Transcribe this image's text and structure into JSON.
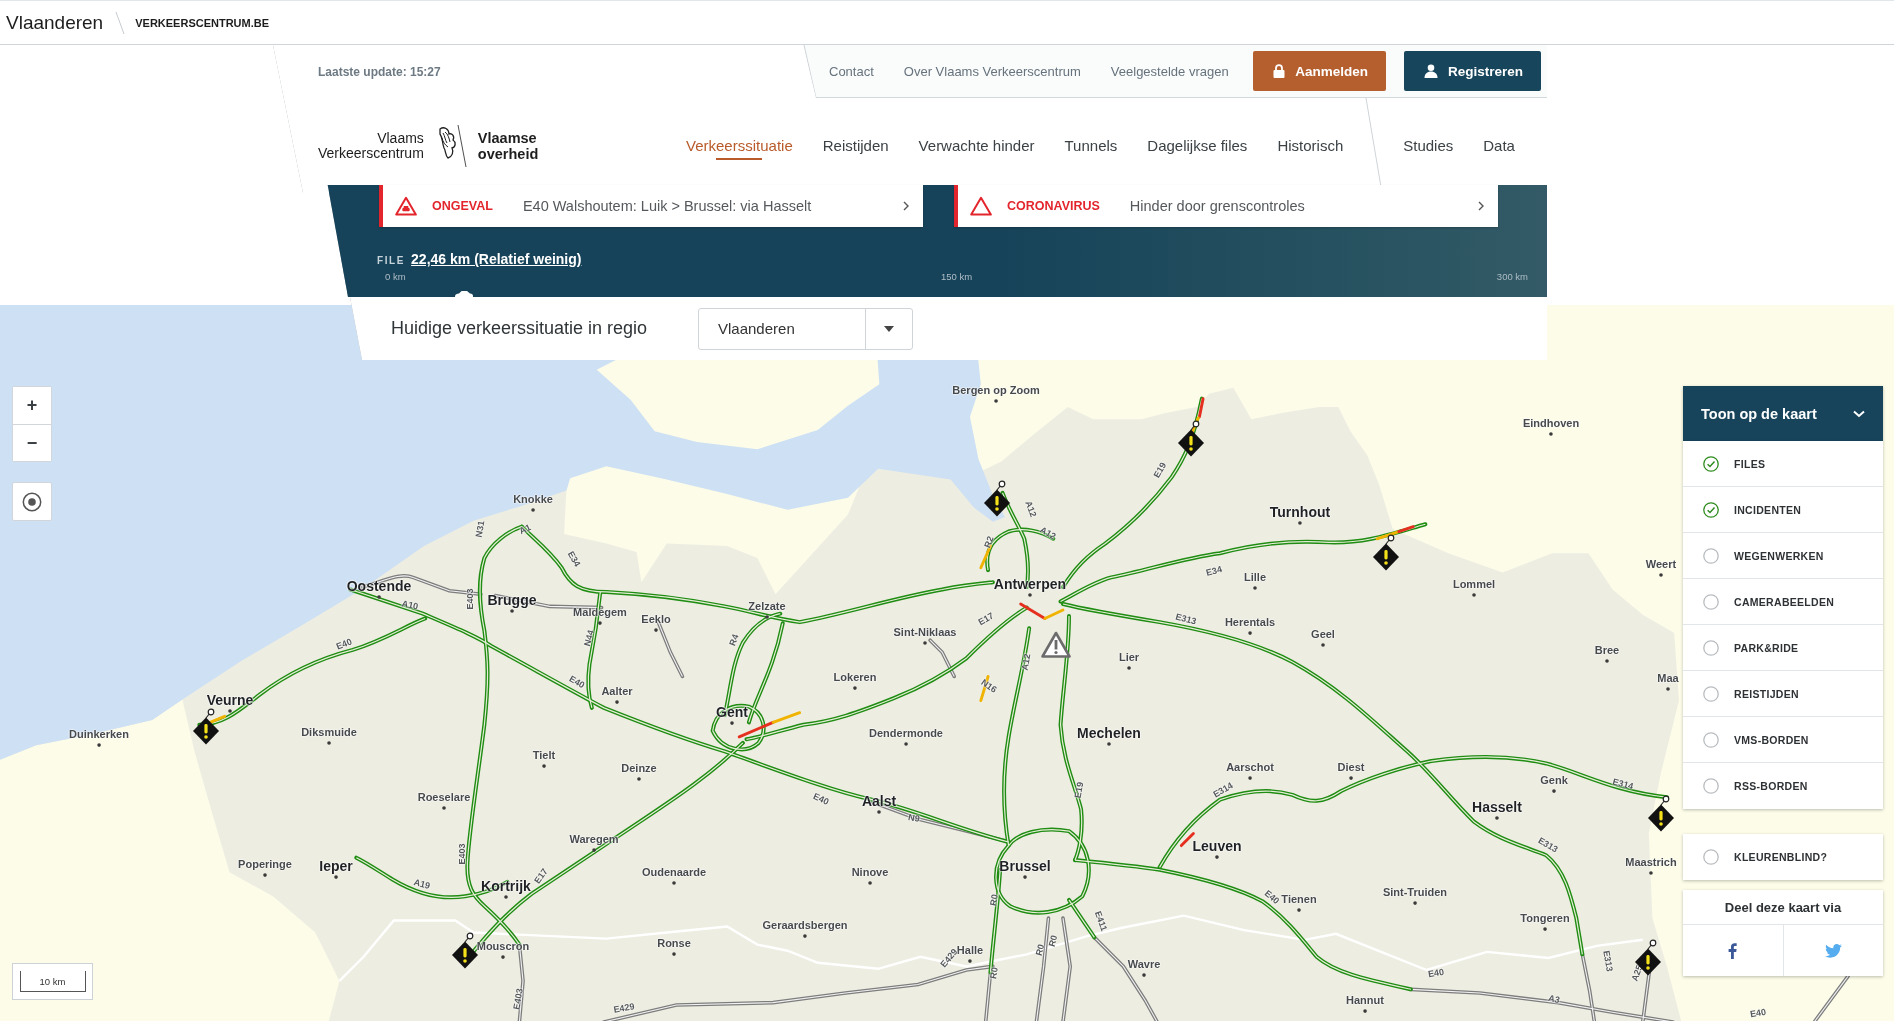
{
  "top_bar": {
    "region": "Vlaanderen",
    "site": "VERKEERSCENTRUM.BE"
  },
  "header": {
    "last_update": "Laatste update: 15:27",
    "links": [
      "Contact",
      "Over Vlaams Verkeerscentrum",
      "Veelgestelde vragen"
    ],
    "buttons": [
      {
        "label": "Aanmelden",
        "kind": "login"
      },
      {
        "label": "Registreren",
        "kind": "register"
      }
    ],
    "logo": {
      "org": [
        "Vlaams",
        "Verkeerscentrum"
      ],
      "government": [
        "Vlaamse",
        "overheid"
      ]
    },
    "nav": [
      {
        "label": "Verkeerssituatie",
        "selected": true
      },
      {
        "label": "Reistijden",
        "selected": false
      },
      {
        "label": "Verwachte hinder",
        "selected": false
      },
      {
        "label": "Tunnels",
        "selected": false
      },
      {
        "label": "Dagelijkse files",
        "selected": false
      },
      {
        "label": "Historisch",
        "selected": false
      }
    ],
    "nav_secondary": [
      {
        "label": "Studies",
        "selected": false
      },
      {
        "label": "Data",
        "selected": false
      }
    ]
  },
  "alerts": [
    {
      "category": "ONGEVAL",
      "text": "E40 Walshoutem: Luik > Brussel: via Hasselt",
      "kind": "accident"
    },
    {
      "category": "CORONAVIRUS",
      "text": "Hinder door grenscontroles",
      "kind": "warning"
    }
  ],
  "traffic_jam": {
    "label": "FILE",
    "value": "22,46 km (Relatief weinig)",
    "level": 0.075,
    "scale": [
      "0 km",
      "150 km",
      "300 km"
    ]
  },
  "region": {
    "label": "Huidige verkeerssituatie in regio",
    "value": "Vlaanderen"
  },
  "map": {
    "zoom_in": "+",
    "zoom_out": "−",
    "scale": "10 km",
    "places": [
      {
        "name": "Bergen op Zoom",
        "kind": "town"
      },
      {
        "name": "Eindhoven",
        "kind": "town"
      },
      {
        "name": "Knokke",
        "kind": "town"
      },
      {
        "name": "Turnhout",
        "kind": "city"
      },
      {
        "name": "Weert",
        "kind": "town"
      },
      {
        "name": "Oostende",
        "kind": "city"
      },
      {
        "name": "Antwerpen",
        "kind": "city"
      },
      {
        "name": "Lille",
        "kind": "town"
      },
      {
        "name": "Lommel",
        "kind": "town"
      },
      {
        "name": "Brugge",
        "kind": "city"
      },
      {
        "name": "Maldegem",
        "kind": "town"
      },
      {
        "name": "Zelzate",
        "kind": "town"
      },
      {
        "name": "Eeklo",
        "kind": "town"
      },
      {
        "name": "Sint-Niklaas",
        "kind": "town"
      },
      {
        "name": "Herentals",
        "kind": "town"
      },
      {
        "name": "Geel",
        "kind": "town"
      },
      {
        "name": "Lier",
        "kind": "town"
      },
      {
        "name": "Bree",
        "kind": "town"
      },
      {
        "name": "Lokeren",
        "kind": "town"
      },
      {
        "name": "Maa",
        "kind": "town"
      },
      {
        "name": "Veurne",
        "kind": "city"
      },
      {
        "name": "Aalter",
        "kind": "town"
      },
      {
        "name": "Gent",
        "kind": "city"
      },
      {
        "name": "Duinkerken",
        "kind": "town"
      },
      {
        "name": "Diksmuide",
        "kind": "town"
      },
      {
        "name": "Dendermonde",
        "kind": "town"
      },
      {
        "name": "Mechelen",
        "kind": "city"
      },
      {
        "name": "Tielt",
        "kind": "town"
      },
      {
        "name": "Deinze",
        "kind": "town"
      },
      {
        "name": "Aarschot",
        "kind": "town"
      },
      {
        "name": "Diest",
        "kind": "town"
      },
      {
        "name": "Genk",
        "kind": "town"
      },
      {
        "name": "Roeselare",
        "kind": "town"
      },
      {
        "name": "Aalst",
        "kind": "city"
      },
      {
        "name": "Hasselt",
        "kind": "city"
      },
      {
        "name": "Waregem",
        "kind": "town"
      },
      {
        "name": "Leuven",
        "kind": "city"
      },
      {
        "name": "Poperinge",
        "kind": "town"
      },
      {
        "name": "Ieper",
        "kind": "city"
      },
      {
        "name": "Oudenaarde",
        "kind": "town"
      },
      {
        "name": "Ninove",
        "kind": "town"
      },
      {
        "name": "Brussel",
        "kind": "city"
      },
      {
        "name": "Maastrich",
        "kind": "town"
      },
      {
        "name": "Kortrijk",
        "kind": "city"
      },
      {
        "name": "Tienen",
        "kind": "town"
      },
      {
        "name": "Sint-Truiden",
        "kind": "town"
      },
      {
        "name": "Geraardsbergen",
        "kind": "town"
      },
      {
        "name": "Tongeren",
        "kind": "town"
      },
      {
        "name": "Mouscron",
        "kind": "town"
      },
      {
        "name": "Ronse",
        "kind": "town"
      },
      {
        "name": "Halle",
        "kind": "town"
      },
      {
        "name": "Wavre",
        "kind": "town"
      },
      {
        "name": "Hannut",
        "kind": "town"
      }
    ],
    "road_labels": [
      "E19",
      "A12",
      "N31",
      "A1",
      "R2",
      "A12",
      "E34",
      "E34",
      "A10",
      "E403",
      "E17",
      "E313",
      "E40",
      "N44",
      "R4",
      "A12",
      "E40",
      "N16",
      "E40",
      "E19",
      "E314",
      "E314",
      "N9",
      "E403",
      "E313",
      "A19",
      "E17",
      "R0",
      "E40",
      "E411",
      "E429",
      "R0",
      "R0",
      "R0",
      "E40",
      "E313",
      "A25",
      "E403",
      "E429",
      "A3",
      "E40"
    ],
    "markers": [
      {
        "kind": "incident"
      },
      {
        "kind": "incident"
      },
      {
        "kind": "incident"
      },
      {
        "kind": "hazard"
      },
      {
        "kind": "incident"
      },
      {
        "kind": "incident"
      },
      {
        "kind": "incident"
      },
      {
        "kind": "incident"
      }
    ]
  },
  "layers": {
    "title": "Toon op de kaart",
    "expanded": true,
    "items": [
      {
        "label": "FILES",
        "checked": true
      },
      {
        "label": "INCIDENTEN",
        "checked": true
      },
      {
        "label": "WEGENWERKEN",
        "checked": false
      },
      {
        "label": "CAMERABEELDEN",
        "checked": false
      },
      {
        "label": "PARK&RIDE",
        "checked": false
      },
      {
        "label": "REISTIJDEN",
        "checked": false
      },
      {
        "label": "VMS-BORDEN",
        "checked": false
      },
      {
        "label": "RSS-BORDEN",
        "checked": false
      }
    ],
    "colorblind": {
      "label": "KLEURENBLIND?",
      "checked": false
    },
    "share": {
      "title": "Deel deze kaart via",
      "networks": [
        {
          "kind": "facebook"
        },
        {
          "kind": "twitter"
        }
      ]
    }
  }
}
